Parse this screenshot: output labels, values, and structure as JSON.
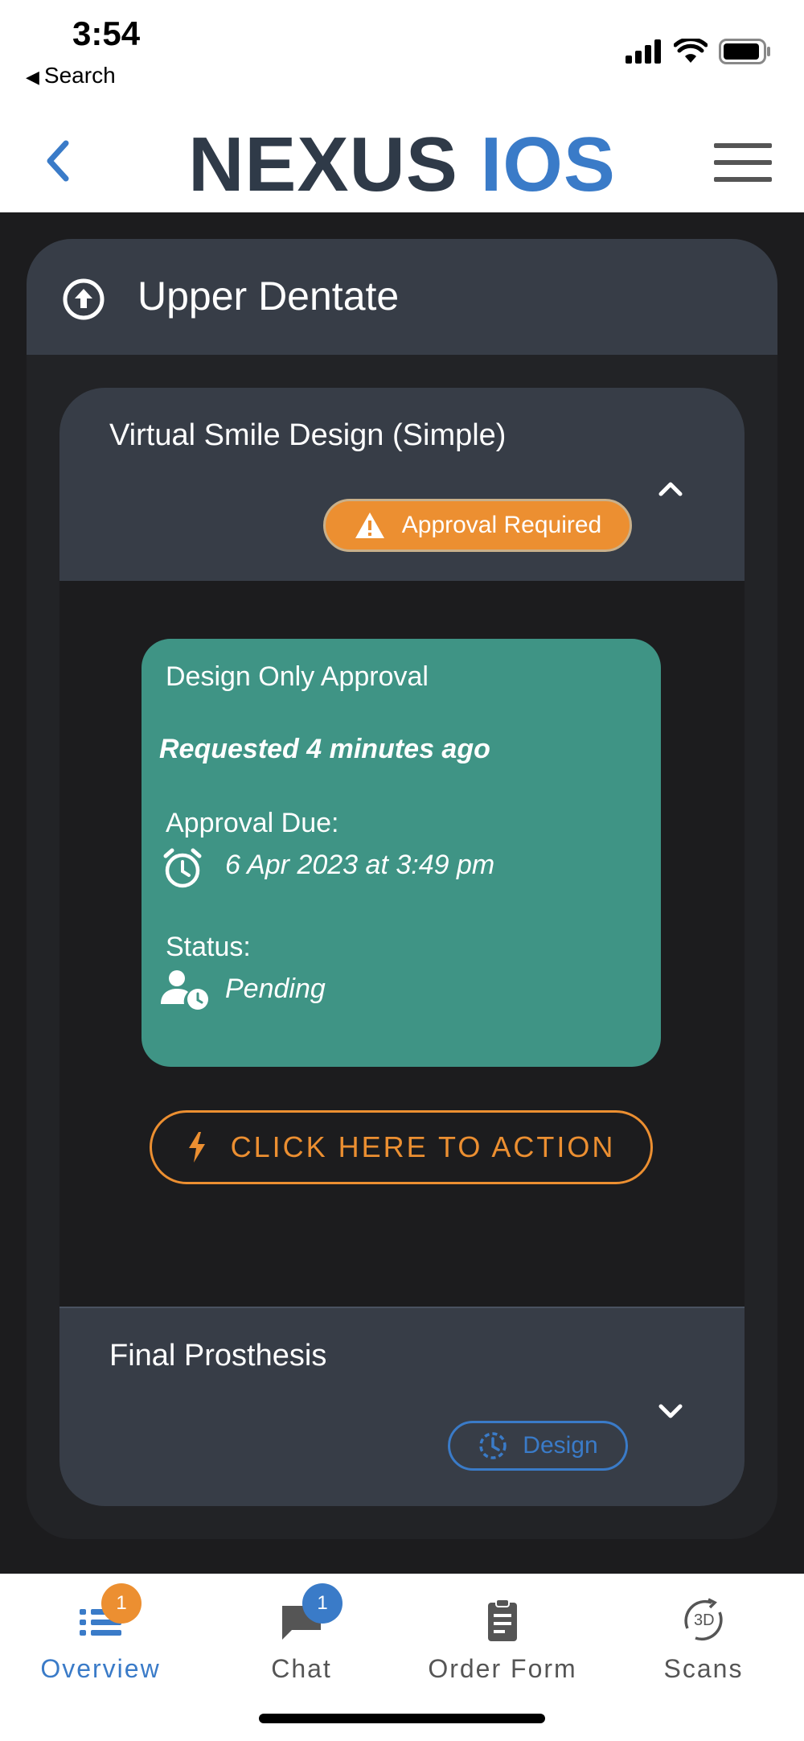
{
  "status_bar": {
    "time": "3:54",
    "back_label": "Search"
  },
  "header": {
    "logo_part1": "NEXUS",
    "logo_part2": "IOS"
  },
  "card": {
    "title": "Upper Dentate",
    "icon": "upload-circle-icon"
  },
  "section1": {
    "title": "Virtual Smile Design (Simple)",
    "badge": "Approval Required",
    "approval": {
      "title": "Design Only Approval",
      "requested": "Requested 4 minutes ago",
      "due_label": "Approval Due:",
      "due_value": "6 Apr 2023 at 3:49 pm",
      "status_label": "Status:",
      "status_value": "Pending"
    },
    "action_label": "CLICK HERE TO ACTION"
  },
  "section2": {
    "title": "Final Prosthesis",
    "badge": "Design"
  },
  "tabbar": {
    "tabs": [
      {
        "label": "Overview",
        "count": "1",
        "icon": "list-icon"
      },
      {
        "label": "Chat",
        "count": "1",
        "icon": "chat-bubble-icon"
      },
      {
        "label": "Order Form",
        "icon": "clipboard-icon"
      },
      {
        "label": "Scans",
        "icon": "3d-rotate-icon"
      }
    ]
  },
  "colors": {
    "accent_orange": "#ec8f31",
    "accent_blue": "#3a7bc8",
    "teal": "#3f9485",
    "panel": "#373d47"
  }
}
